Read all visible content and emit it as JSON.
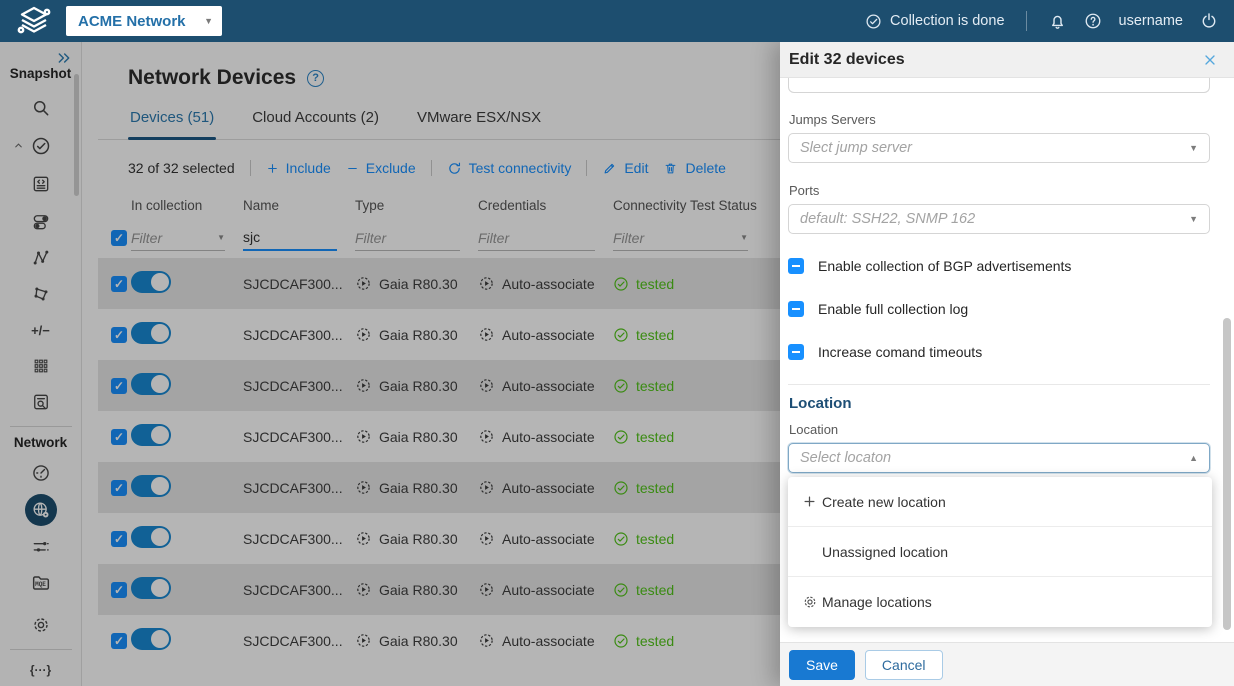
{
  "topbar": {
    "brand": "ACME Network",
    "status": "Collection is done",
    "username": "username"
  },
  "sidebar": {
    "snapshot_label": "Snapshot",
    "network_label": "Network",
    "snapshot_icons": [
      "search-icon",
      "check-circle-icon",
      "code-document-icon",
      "toggles-icon",
      "path-lookup-icon",
      "topology-icon",
      "plus-minus-icon",
      "grid-icon",
      "report-search-icon"
    ],
    "network_icons": [
      "dashboard-gauge-icon",
      "discovery-globe-gear-icon (active)",
      "sliders-icon",
      "mqe-folder-icon",
      "settings-gear-icon",
      "braces-icon"
    ]
  },
  "icons": {
    "check": "✓",
    "caret_down": "▼",
    "caret_up": "▲",
    "plus_minus": "+/−",
    "braces": "{···}",
    "mqe": "MQE",
    "question": "?"
  },
  "page": {
    "title": "Network Devices",
    "tabs": [
      {
        "label": "Devices (51)"
      },
      {
        "label": "Cloud Accounts (2)"
      },
      {
        "label": "VMware ESX/NSX"
      }
    ],
    "toolbar": {
      "selection": "32 of 32 selected",
      "include": "Include",
      "exclude": "Exclude",
      "test": "Test connectivity",
      "edit": "Edit",
      "delete": "Delete"
    },
    "table": {
      "columns": [
        "In collection",
        "Name",
        "Type",
        "Credentials",
        "Connectivity Test Status"
      ],
      "filter_placeholder": "Filter",
      "name_filter_value": "sjc",
      "rows": [
        {
          "name": "SJCDCAF300...",
          "type": "Gaia R80.30",
          "credentials": "Auto-associate",
          "status": "tested"
        },
        {
          "name": "SJCDCAF300...",
          "type": "Gaia R80.30",
          "credentials": "Auto-associate",
          "status": "tested"
        },
        {
          "name": "SJCDCAF300...",
          "type": "Gaia R80.30",
          "credentials": "Auto-associate",
          "status": "tested"
        },
        {
          "name": "SJCDCAF300...",
          "type": "Gaia R80.30",
          "credentials": "Auto-associate",
          "status": "tested"
        },
        {
          "name": "SJCDCAF300...",
          "type": "Gaia R80.30",
          "credentials": "Auto-associate",
          "status": "tested"
        },
        {
          "name": "SJCDCAF300...",
          "type": "Gaia R80.30",
          "credentials": "Auto-associate",
          "status": "tested"
        },
        {
          "name": "SJCDCAF300...",
          "type": "Gaia R80.30",
          "credentials": "Auto-associate",
          "status": "tested"
        },
        {
          "name": "SJCDCAF300...",
          "type": "Gaia R80.30",
          "credentials": "Auto-associate",
          "status": "tested"
        }
      ]
    }
  },
  "drawer": {
    "title": "Edit 32 devices",
    "fields": {
      "jumps_label": "Jumps Servers",
      "jumps_placeholder": "Slect jump server",
      "ports_label": "Ports",
      "ports_placeholder": "default: SSH22, SNMP 162"
    },
    "checkboxes": [
      {
        "label": "Enable collection of BGP advertisements"
      },
      {
        "label": "Enable full collection log"
      },
      {
        "label": "Increase comand timeouts"
      }
    ],
    "location": {
      "heading": "Location",
      "label": "Location",
      "placeholder": "Select locaton"
    },
    "dropdown": [
      {
        "label": "Create new location"
      },
      {
        "label": "Unassigned location"
      },
      {
        "label": "Manage locations"
      }
    ],
    "footer": {
      "save": "Save",
      "cancel": "Cancel"
    }
  },
  "colors": {
    "topbar": "#1d4e6f",
    "accent": "#1890ff",
    "success": "#52c41a",
    "save_button": "#1879d2"
  }
}
